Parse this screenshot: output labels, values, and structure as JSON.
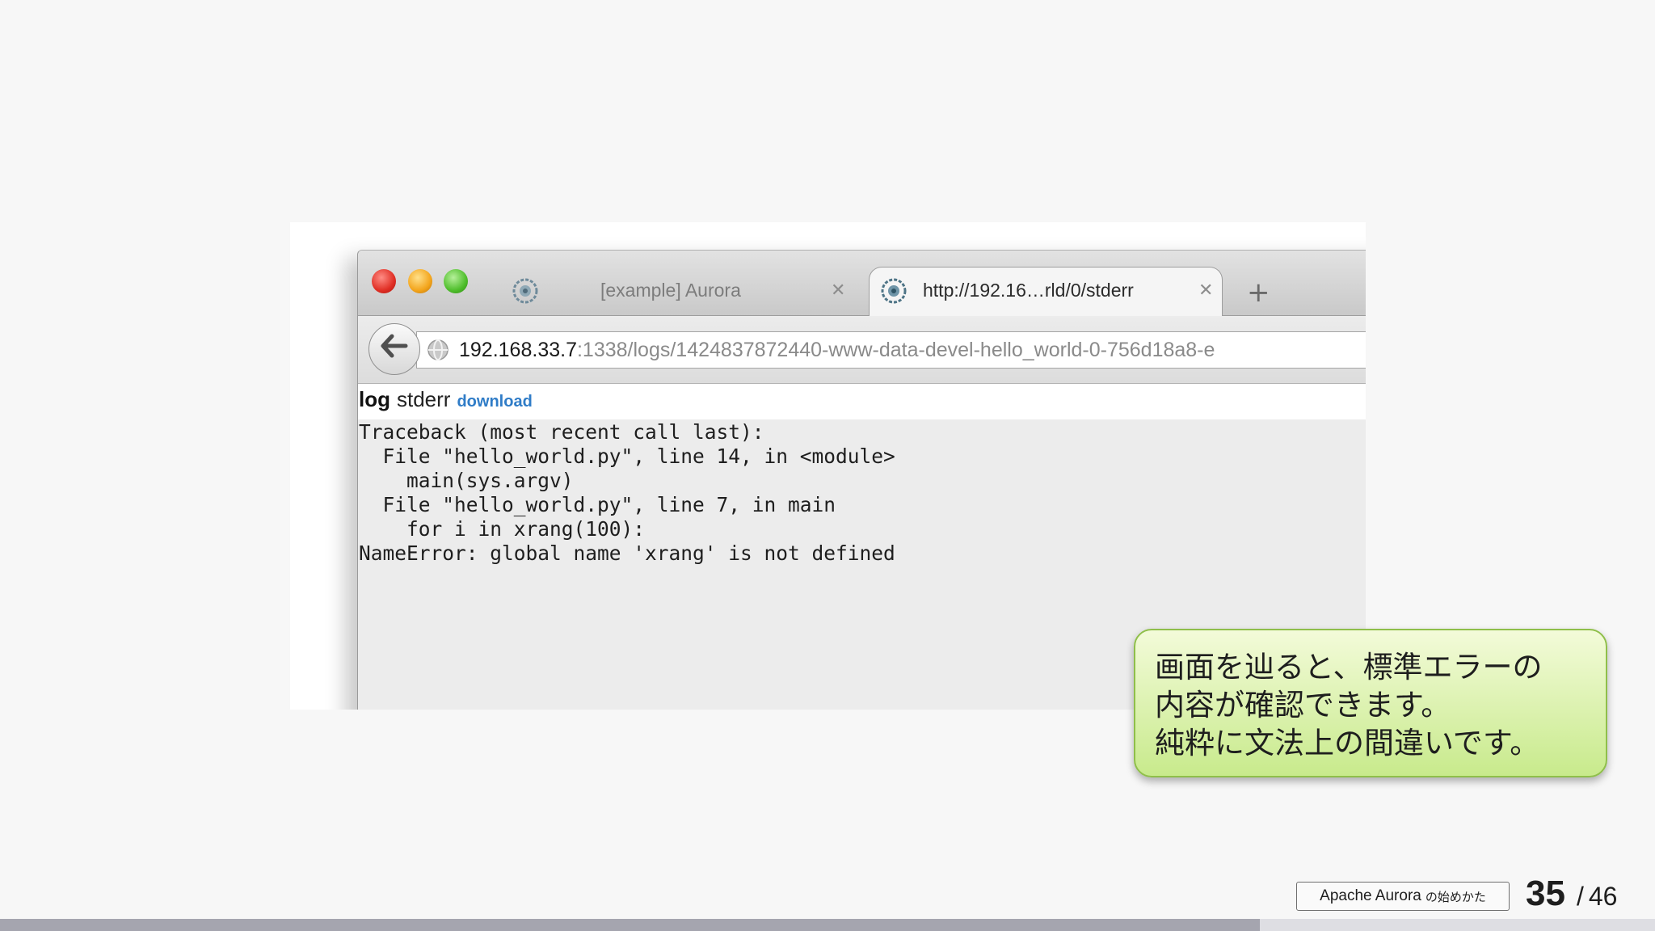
{
  "browser": {
    "tabs": [
      {
        "title": "[example] Aurora",
        "active": false
      },
      {
        "title": "http://192.16…rld/0/stderr",
        "active": true
      }
    ],
    "close_glyph": "✕",
    "new_tab_glyph": "+",
    "back_glyph": "🡐",
    "url": {
      "host": "192.168.33.7",
      "path": ":1338/logs/1424837872440-www-data-devel-hello_world-0-756d18a8-e"
    }
  },
  "log_page": {
    "title": "log",
    "stream": "stderr",
    "download_label": "download",
    "lines": [
      "Traceback (most recent call last):",
      "  File \"hello_world.py\", line 14, in <module>",
      "    main(sys.argv)",
      "  File \"hello_world.py\", line 7, in main",
      "    for i in xrang(100):",
      "NameError: global name 'xrang' is not defined"
    ]
  },
  "callout": {
    "lines": [
      "画面を辿ると、標準エラーの",
      "内容が確認できます。",
      "純粋に文法上の間違いです。"
    ]
  },
  "footer": {
    "badge_title": "Apache Aurora",
    "badge_subtitle": "の始めかた",
    "page_current": "35",
    "page_separator": "/",
    "page_total": "46",
    "progress": 0.761
  },
  "colors": {
    "callout_bg": "#d9f2a8",
    "link": "#2f7cc7",
    "progress_fill": "#a5a5af",
    "progress_track": "#dedee3"
  },
  "icons": [
    "aurora-favicon-icon",
    "globe-icon",
    "back-arrow-icon",
    "close-icon",
    "plus-icon"
  ]
}
